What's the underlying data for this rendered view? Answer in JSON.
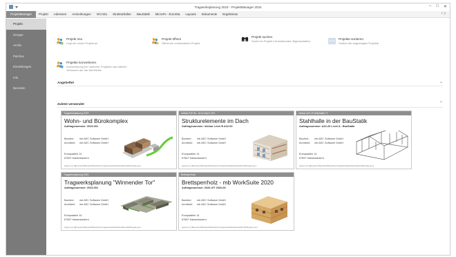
{
  "window": {
    "title": "Tragwerksplanung 2023 - ProjektManager 2024",
    "controls": [
      "–",
      "□",
      "✕"
    ]
  },
  "menu": {
    "items": [
      "ProjektManager",
      "Projekt",
      "Adressen",
      "Anmerkungen",
      "ViCADo",
      "StrukturEditor",
      "BauStatik",
      "MicroFe - EuroSta",
      "Layouts",
      "Dokumente",
      "Ergebnisse"
    ],
    "right": "^ ?"
  },
  "sidebar": {
    "items": [
      "Projekt",
      "Gruppe",
      "Archiv",
      "Patches",
      "Einstellungen",
      "Info",
      "Beenden"
    ]
  },
  "actions": [
    {
      "title": "Projekt neu",
      "desc": "Legt ein neues Projekt an",
      "icon": "people-plus-icon"
    },
    {
      "title": "Projekt öffnen",
      "desc": "Öffnet ein vorhandenes Projekt",
      "icon": "people-open-icon"
    },
    {
      "title": "Projekt suchen",
      "desc": "Sucht ein Projekt mit bestimmten Eigenschaften",
      "icon": "binoculars-icon"
    },
    {
      "title": "Projekte sortieren",
      "desc": "Sortiert die angezeigten Projekte",
      "icon": "list-sort-icon"
    },
    {
      "title": "Projekte konvertieren",
      "desc": "Konvertierung ein mehrerer Projekten aus älteren Versionen der mb WorkSuite",
      "icon": "people-convert-icon"
    }
  ],
  "sections": {
    "pinned": "Angeheftet",
    "recent": "Zuletzt verwendet"
  },
  "labels": {
    "bauherr": "Bauherr:",
    "architekt": "Architekt:"
  },
  "cards": [
    {
      "header": "Tragwerksplanung 2023",
      "name": "Wohn- und Bürokomplex",
      "number": "Auftragsnummer: 2023-001",
      "bauherr": "mb AEC Software GmbH",
      "architekt": "mb AEC Software GmbH",
      "street": "Europaallee 14",
      "city": "67657 Kaiserslautern",
      "path": "System (C:)\\Benutzer\\Öffentlich\\Öffentliche Projekte\\mbWorkSuite\\2023-001\\Projekt.prmo"
    },
    {
      "header": "mbinar KW 46 - 16 im Dach V2X",
      "name": "Strukturelemente im Dach",
      "number": "Auftragsnummer: mbinar Level B A22-03",
      "bauherr": "mb AEC Software GmbH",
      "architekt": "mb AEC Software GmbH",
      "street": "Europaallee 14",
      "city": "67657 Kaiserslautern",
      "path": "System (C:)\\Benutzer\\Öffentlich\\Öffentliche Projekte\\mbWorkSuite\\A22-03\\Projekt.prmo"
    },
    {
      "header": "mbinar A22-20 Stahlhalle T1",
      "name": "Stahlhalle in der BauStatik",
      "number": "Auftragsnummer: A22-20 Level A - BauStatik",
      "bauherr": "mb AEC Software GmbH",
      "architekt": "mb AEC Software GmbH",
      "street": "Europaallee 14",
      "city": "67657 Kaiserslautern",
      "path": "System (C:)\\Benutzer\\Öffentlich\\Öffentliche Projekte\\mbWorkSuite\\A22-20\\Projekt.prmo"
    },
    {
      "header": "Tragwerksplanung 2023",
      "name": "Tragwerksplanung \"Winnender Tor\"",
      "number": "Auftragsnummer: 2023-001",
      "bauherr": "mb AEC Software GmbH",
      "architekt": "mb AEC Software GmbH",
      "street": "Europaallee 14",
      "city": "67657 Kaiserslautern",
      "path": "System (C:)\\Benutzer\\Öffentlich\\Öffentliche Projekte\\mbWorkSuite\\2023-002\\Projekt.prmo"
    },
    {
      "header": "Brettsperrholz",
      "name": "Brettsperrholz - mb WorkSuite 2020",
      "number": "Auftragsnummer: 2020-VIT 2020-05",
      "bauherr": "mb AEC Software GmbH",
      "architekt": "mb AEC Software GmbH",
      "street": "Europaallee 14",
      "city": "67657 Kaiserslautern",
      "path": "System (C:)\\Benutzer\\Öffentlich\\Öffentliche Projekte\\mbWorkSuite\\2020-05\\Projekt.prmo"
    }
  ]
}
